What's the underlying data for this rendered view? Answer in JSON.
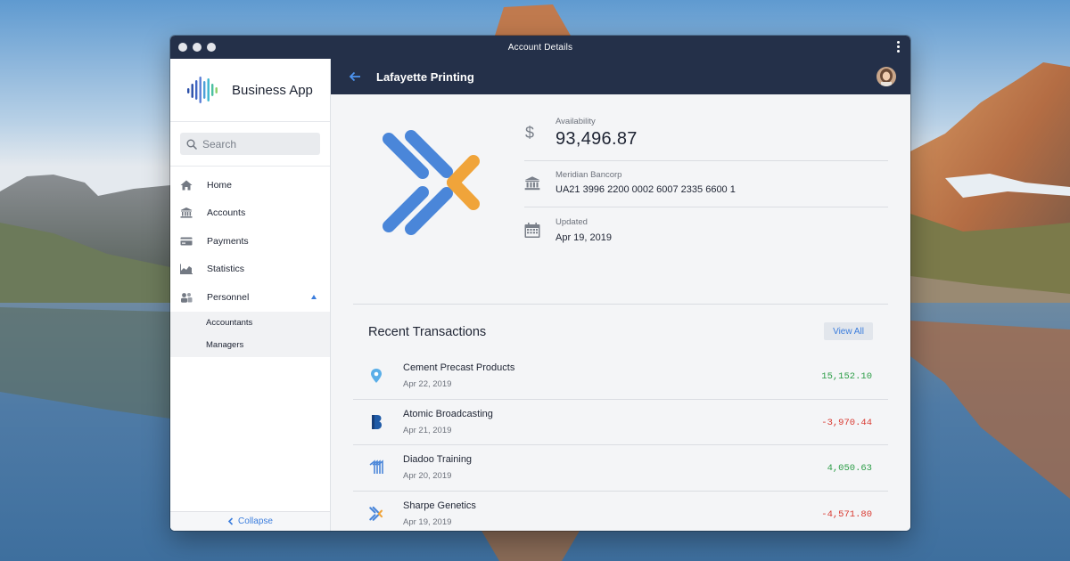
{
  "window": {
    "title": "Account Details"
  },
  "sidebar": {
    "brand": "Business App",
    "search_placeholder": "Search",
    "items": [
      {
        "label": "Home",
        "icon": "home-icon"
      },
      {
        "label": "Accounts",
        "icon": "bank-icon"
      },
      {
        "label": "Payments",
        "icon": "credit-card-icon"
      },
      {
        "label": "Statistics",
        "icon": "chart-icon"
      },
      {
        "label": "Personnel",
        "icon": "people-icon",
        "expanded": true
      }
    ],
    "subitems": [
      {
        "label": "Accountants"
      },
      {
        "label": "Managers"
      }
    ],
    "collapse_label": "Collapse"
  },
  "header": {
    "account_name": "Lafayette Printing"
  },
  "account": {
    "availability_label": "Availability",
    "availability_value": "93,496.87",
    "bank_label": "Meridian Bancorp",
    "iban": "UA21 3996 2200 0002 6007 2335 6600 1",
    "updated_label": "Updated",
    "updated_value": "Apr 19, 2019"
  },
  "transactions": {
    "title": "Recent Transactions",
    "view_all": "View All",
    "rows": [
      {
        "name": "Cement Precast Products",
        "date": "Apr 22, 2019",
        "amount": "15,152.10",
        "type": "positive"
      },
      {
        "name": "Atomic Broadcasting",
        "date": "Apr 21, 2019",
        "amount": "-3,970.44",
        "type": "negative"
      },
      {
        "name": "Diadoo Training",
        "date": "Apr 20, 2019",
        "amount": "4,050.63",
        "type": "positive"
      },
      {
        "name": "Sharpe Genetics",
        "date": "Apr 19, 2019",
        "amount": "-4,571.80",
        "type": "negative"
      }
    ]
  },
  "colors": {
    "navy": "#243049",
    "accent_blue": "#3b7ddd",
    "logo_blue": "#4a86d9",
    "logo_orange": "#f0a43a",
    "positive": "#2c9d47",
    "negative": "#d93b32"
  }
}
